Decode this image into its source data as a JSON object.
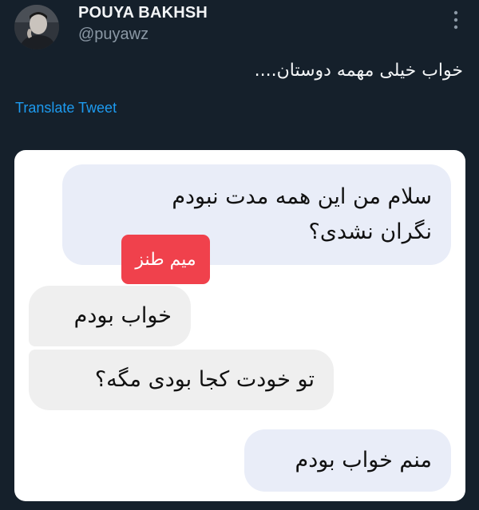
{
  "author": {
    "display_name": "POUYA BAKHSH",
    "handle": "@puyawz",
    "avatar_icon": "user-avatar"
  },
  "header": {
    "more_icon": "more-vertical-icon"
  },
  "tweet": {
    "text": "خواب خیلی مهمه دوستان....",
    "translate_label": "Translate Tweet"
  },
  "media": {
    "messages": [
      {
        "lines": [
          "سلام من این همه مدت نبودم",
          "نگران نشدی؟"
        ]
      },
      {
        "text": "خواب بودم"
      },
      {
        "text": "تو خودت کجا بودی مگه؟"
      },
      {
        "text": "منم خواب بودم"
      }
    ],
    "badge_text": "میم طنز"
  },
  "colors": {
    "background": "#15202b",
    "link": "#1d9bf0",
    "badge": "#f0414c",
    "incoming_bubble": "#e9edf8",
    "outgoing_bubble": "#efefef"
  }
}
